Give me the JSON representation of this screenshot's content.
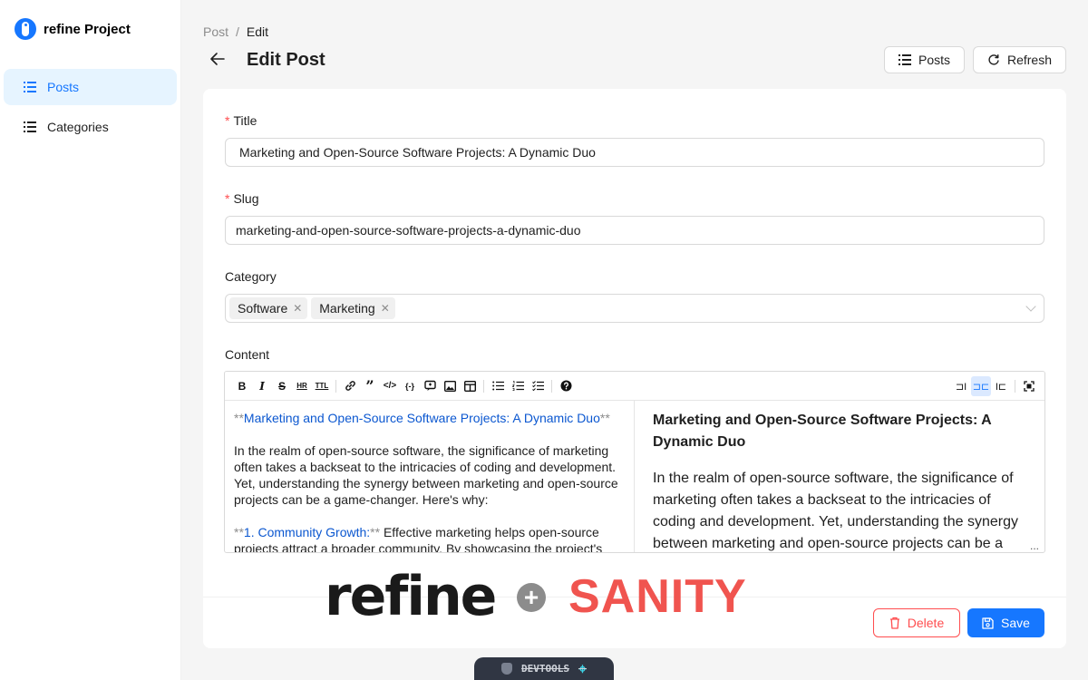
{
  "app": {
    "title": "refine Project"
  },
  "sidebar": {
    "items": [
      {
        "label": "Posts",
        "active": true
      },
      {
        "label": "Categories",
        "active": false
      }
    ]
  },
  "header": {
    "breadcrumb": [
      "Post",
      "Edit"
    ],
    "breadcrumb_sep": "/",
    "title": "Edit Post",
    "posts_label": "Posts",
    "refresh_label": "Refresh"
  },
  "form": {
    "title_label": "Title",
    "title_value": "Marketing and Open-Source Software Projects: A Dynamic Duo",
    "slug_label": "Slug",
    "slug_value": "marketing-and-open-source-software-projects-a-dynamic-duo",
    "category_label": "Category",
    "categories": [
      "Software",
      "Marketing"
    ],
    "content_label": "Content",
    "required_mark": "*"
  },
  "editor": {
    "markdown": {
      "heading_open": "**",
      "heading_text": "Marketing and Open-Source Software Projects: A Dynamic Duo",
      "heading_close": "**",
      "para1": "In the realm of open-source software, the significance of marketing often takes a backseat to the intricacies of coding and development. Yet, understanding the synergy between marketing and open-source projects can be a game-changer. Here's why:",
      "item_open": "**",
      "item_text": "1. Community Growth:",
      "item_close": "**",
      "item_rest": " Effective marketing helps open-source projects attract a broader community. By showcasing the project's"
    },
    "preview": {
      "heading": "Marketing and Open-Source Software Projects: A Dynamic Duo",
      "para": "In the realm of open-source software, the significance of marketing often takes a backseat to the intricacies of coding and development. Yet, understanding the synergy between marketing and open-source projects can be a game-changer."
    },
    "ellipsis": "..."
  },
  "footer": {
    "delete_label": "Delete",
    "save_label": "Save"
  },
  "overlay": {
    "refine_logo": "refine",
    "plus": "+",
    "sanity_logo": "SANITY"
  },
  "devtools": {
    "label": "DEVTOOLS"
  },
  "colors": {
    "primary": "#1677ff",
    "danger": "#ff4d4f",
    "sanity": "#f0544f"
  }
}
